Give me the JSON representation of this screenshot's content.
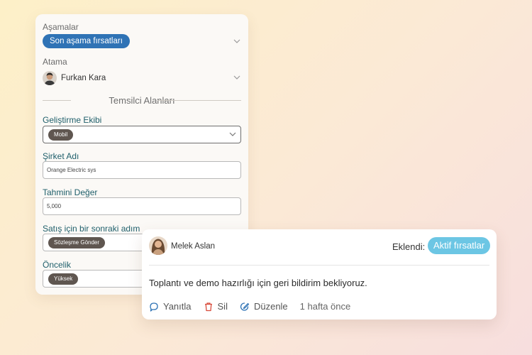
{
  "stages": {
    "label": "Aşamalar",
    "value": "Son aşama fırsatları"
  },
  "assignment": {
    "label": "Atama",
    "value": "Furkan Kara"
  },
  "section_title": "Temsilci Alanları",
  "fields": {
    "dev_team": {
      "label": "Geliştirme Ekibi",
      "tag": "Mobil"
    },
    "company": {
      "label": "Şirket Adı",
      "value": "Orange Electric sys"
    },
    "estimated_value": {
      "label": "Tahmini Değer",
      "value": "5,000"
    },
    "next_step": {
      "label": "Satış için bir sonraki adım",
      "tag": "Sözleşme Gönder"
    },
    "priority": {
      "label": "Öncelik",
      "tag": "Yüksek"
    }
  },
  "comment": {
    "author": "Melek Aslan",
    "added_label": "Eklendi:",
    "added_target": "Aktif fırsatlar",
    "text": "Toplantı ve demo hazırlığı için geri bildirim bekliyoruz.",
    "actions": {
      "reply": "Yanıtla",
      "delete": "Sil",
      "edit": "Düzenle"
    },
    "time": "1 hafta önce"
  },
  "colors": {
    "stage_pill": "#2f73b5",
    "active_pill": "#6cc6e4",
    "tag": "#5f5650",
    "label_teal": "#1f5f6b"
  },
  "icons": [
    "chevron-down-icon",
    "reply-icon",
    "trash-icon",
    "edit-icon"
  ]
}
